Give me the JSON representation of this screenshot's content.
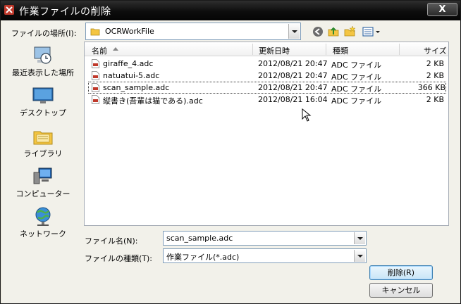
{
  "window": {
    "title": "作業ファイルの削除",
    "close_label": "X"
  },
  "lookin": {
    "label": "ファイルの場所(I):",
    "value": "OCRWorkFile"
  },
  "places": [
    {
      "label": "最近表示した場所",
      "icon": "recent-places-icon"
    },
    {
      "label": "デスクトップ",
      "icon": "desktop-icon"
    },
    {
      "label": "ライブラリ",
      "icon": "libraries-icon"
    },
    {
      "label": "コンピューター",
      "icon": "computer-icon"
    },
    {
      "label": "ネットワーク",
      "icon": "network-icon"
    }
  ],
  "columns": {
    "name": "名前",
    "date": "更新日時",
    "type": "種類",
    "size": "サイズ"
  },
  "files": [
    {
      "name": "giraffe_4.adc",
      "date": "2012/08/21 20:47",
      "type": "ADC ファイル",
      "size": "2 KB"
    },
    {
      "name": "natuatui-5.adc",
      "date": "2012/08/21 20:47",
      "type": "ADC ファイル",
      "size": "2 KB"
    },
    {
      "name": "scan_sample.adc",
      "date": "2012/08/21 20:47",
      "type": "ADC ファイル",
      "size": "366 KB"
    },
    {
      "name": "縦書き(吾輩は猫である).adc",
      "date": "2012/08/21 16:04",
      "type": "ADC ファイル",
      "size": "2 KB"
    }
  ],
  "filename": {
    "label": "ファイル名(N):",
    "value": "scan_sample.adc"
  },
  "filetype": {
    "label": "ファイルの種類(T):",
    "value": "作業ファイル(*.adc)"
  },
  "buttons": {
    "delete": "削除(R)",
    "cancel": "キャンセル"
  },
  "colors": {
    "titlebar": "#0d0d0d",
    "accent": "#3c7fb1"
  }
}
